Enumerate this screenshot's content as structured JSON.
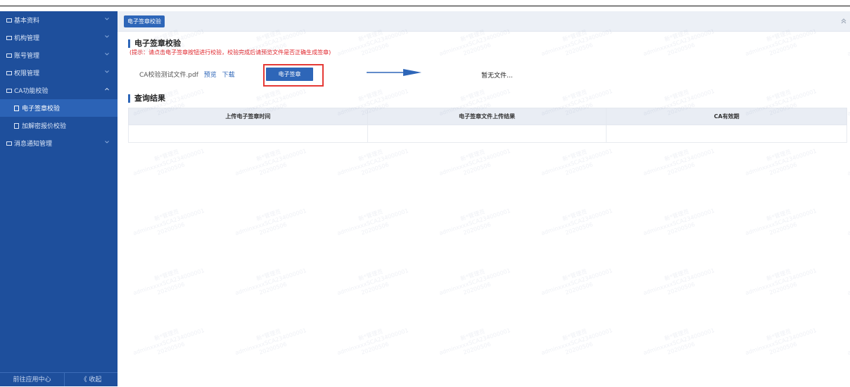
{
  "sidebar": {
    "items": [
      {
        "label": "基本资料",
        "expanded": false
      },
      {
        "label": "机构管理",
        "expanded": false
      },
      {
        "label": "账号管理",
        "expanded": false
      },
      {
        "label": "权限管理",
        "expanded": false
      },
      {
        "label": "CA功能校验",
        "expanded": true
      }
    ],
    "sub_items": [
      {
        "label": "电子签章校验",
        "active": true
      },
      {
        "label": "加解密报价校验",
        "active": false
      }
    ],
    "last_item": {
      "label": "消息通知管理"
    },
    "footer": {
      "app_center": "前往应用中心",
      "collapse": "《 收起"
    }
  },
  "tabs": [
    {
      "label": "电子签章校验"
    }
  ],
  "section1": {
    "title": "电子签章校验",
    "hint": "(提示：请点击电子签章按钮进行校验，校验完成后请预览文件是否正确生成签章)"
  },
  "file": {
    "name": "CA校验测试文件.pdf",
    "preview": "预览",
    "download": "下载"
  },
  "sign_button": "电子签章",
  "no_file": "暂无文件...",
  "section2": {
    "title": "查询结果"
  },
  "table": {
    "headers": [
      "上传电子签章时间",
      "电子签章文件上传结果",
      "CA有效期"
    ]
  },
  "colors": {
    "sidebar": "#1e4f9c",
    "accent": "#2e66b8",
    "highlight_frame": "#e53935",
    "hint": "#e0262c"
  },
  "watermark": {
    "line1": "新*管理员",
    "line2": "adminxxxxSCA234000001",
    "line3": "20200506"
  }
}
